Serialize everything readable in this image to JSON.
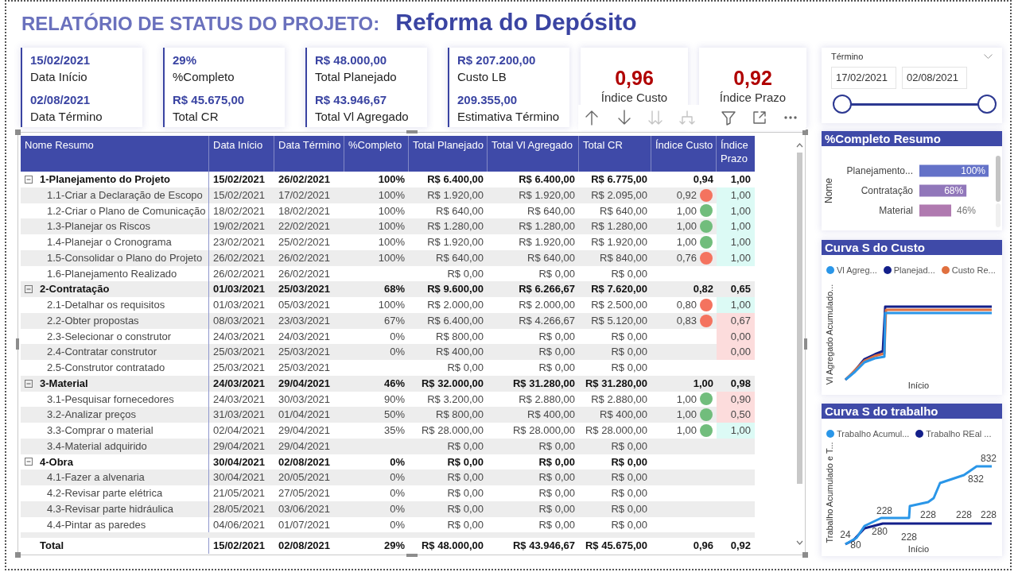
{
  "title": {
    "prefix": "RELATÓRIO DE STATUS DO PROJETO:",
    "project": "Reforma do Depósito"
  },
  "kpi_cards": [
    {
      "kind": "pair",
      "items": [
        {
          "value": "15/02/2021",
          "label": "Data Início"
        },
        {
          "value": "02/08/2021",
          "label": "Data Término"
        }
      ]
    },
    {
      "kind": "pair",
      "items": [
        {
          "value": "29%",
          "label": "%Completo"
        },
        {
          "value": "R$ 45.675,00",
          "label": "Total CR"
        }
      ]
    },
    {
      "kind": "pair",
      "items": [
        {
          "value": "R$ 48.000,00",
          "label": "Total Planejado"
        },
        {
          "value": "R$ 43.946,67",
          "label": "Total Vl Agregado"
        }
      ]
    },
    {
      "kind": "pair",
      "items": [
        {
          "value": "R$ 207.200,00",
          "label": "Custo LB"
        },
        {
          "value": "209.355,00",
          "label": "Estimativa Término"
        }
      ]
    },
    {
      "kind": "index",
      "value": "0,96",
      "label": "Índice Custo"
    },
    {
      "kind": "index",
      "value": "0,92",
      "label": "Índice Prazo"
    }
  ],
  "table_toolbar": [
    {
      "kind": "up",
      "disabled": false
    },
    {
      "kind": "down",
      "disabled": false
    },
    {
      "kind": "drilldown",
      "disabled": true
    },
    {
      "kind": "expand",
      "disabled": true
    },
    {
      "kind": "filter",
      "disabled": false
    },
    {
      "kind": "focus",
      "disabled": false
    },
    {
      "kind": "more",
      "disabled": false
    }
  ],
  "table": {
    "columns": [
      "Nome Resumo",
      "Data Início",
      "Data Término",
      "%Completo",
      "Total Planejado",
      "Total Vl Agregado",
      "Total CR",
      "Índice Custo",
      "Índice Prazo"
    ],
    "rows": [
      {
        "kind": "group",
        "expanded": true,
        "name": "1-Planejamento do Projeto",
        "start": "15/02/2021",
        "end": "26/02/2021",
        "complete": "100%",
        "planned": "R$ 6.400,00",
        "earned": "R$ 6.400,00",
        "actual": "R$ 6.775,00",
        "cost_index": {
          "value": "0,94"
        },
        "schedule_index": {
          "value": "1,00"
        }
      },
      {
        "kind": "task",
        "name": "1.1-Criar a Declaração de Escopo",
        "start": "15/02/2021",
        "end": "17/02/2021",
        "complete": "100%",
        "planned": "R$ 1.920,00",
        "earned": "R$ 1.920,00",
        "actual": "R$ 2.095,00",
        "cost_index": {
          "value": "0,92",
          "color": "#f4735f"
        },
        "schedule_index": {
          "value": "1,00",
          "color": "#dcfaf5"
        }
      },
      {
        "kind": "task",
        "name": "1.2-Criar o Plano de Comunicação",
        "start": "18/02/2021",
        "end": "18/02/2021",
        "complete": "100%",
        "planned": "R$ 640,00",
        "earned": "R$ 640,00",
        "actual": "R$ 640,00",
        "cost_index": {
          "value": "1,00",
          "color": "#71bd7c"
        },
        "schedule_index": {
          "value": "1,00",
          "color": "#dcfaf5"
        }
      },
      {
        "kind": "task",
        "name": "1.3-Planejar os Riscos",
        "start": "19/02/2021",
        "end": "22/02/2021",
        "complete": "100%",
        "planned": "R$ 1.280,00",
        "earned": "R$ 1.280,00",
        "actual": "R$ 1.280,00",
        "cost_index": {
          "value": "1,00",
          "color": "#71bd7c"
        },
        "schedule_index": {
          "value": "1,00",
          "color": "#dcfaf5"
        }
      },
      {
        "kind": "task",
        "name": "1.4-Planejar o Cronograma",
        "start": "23/02/2021",
        "end": "25/02/2021",
        "complete": "100%",
        "planned": "R$ 1.920,00",
        "earned": "R$ 1.920,00",
        "actual": "R$ 1.920,00",
        "cost_index": {
          "value": "1,00",
          "color": "#71bd7c"
        },
        "schedule_index": {
          "value": "1,00",
          "color": "#dcfaf5"
        }
      },
      {
        "kind": "task",
        "name": "1.5-Consolidar o Plano do Projeto",
        "start": "26/02/2021",
        "end": "26/02/2021",
        "complete": "100%",
        "planned": "R$ 640,00",
        "earned": "R$ 640,00",
        "actual": "R$ 840,00",
        "cost_index": {
          "value": "0,76",
          "color": "#f4735f"
        },
        "schedule_index": {
          "value": "1,00",
          "color": "#dcfaf5"
        }
      },
      {
        "kind": "task",
        "name": "1.6-Planejamento Realizado",
        "start": "26/02/2021",
        "end": "26/02/2021",
        "planned": "R$ 0,00",
        "earned": "R$ 0,00",
        "actual": "R$ 0,00"
      },
      {
        "kind": "group",
        "expanded": true,
        "name": "2-Contratação",
        "start": "01/03/2021",
        "end": "25/03/2021",
        "complete": "68%",
        "planned": "R$ 9.600,00",
        "earned": "R$ 6.266,67",
        "actual": "R$ 7.620,00",
        "cost_index": {
          "value": "0,82"
        },
        "schedule_index": {
          "value": "0,65"
        }
      },
      {
        "kind": "task",
        "name": "2.1-Detalhar os requisitos",
        "start": "01/03/2021",
        "end": "05/03/2021",
        "complete": "100%",
        "planned": "R$ 2.000,00",
        "earned": "R$ 2.000,00",
        "actual": "R$ 2.500,00",
        "cost_index": {
          "value": "0,80",
          "color": "#f4735f"
        },
        "schedule_index": {
          "value": "1,00",
          "color": "#dcfaf5"
        }
      },
      {
        "kind": "task",
        "name": "2.2-Obter propostas",
        "start": "08/03/2021",
        "end": "23/03/2021",
        "complete": "67%",
        "planned": "R$ 6.400,00",
        "earned": "R$ 4.266,67",
        "actual": "R$ 5.120,00",
        "cost_index": {
          "value": "0,83",
          "color": "#f4735f"
        },
        "schedule_index": {
          "value": "0,67",
          "color": "#fcdcdc"
        }
      },
      {
        "kind": "task",
        "name": "2.3-Selecionar o construtor",
        "start": "24/03/2021",
        "end": "24/03/2021",
        "complete": "0%",
        "planned": "R$ 800,00",
        "earned": "R$ 0,00",
        "actual": "R$ 0,00",
        "schedule_index": {
          "value": "0,00",
          "color": "#fcdcdc"
        }
      },
      {
        "kind": "task",
        "name": "2.4-Contratar construtor",
        "start": "25/03/2021",
        "end": "25/03/2021",
        "complete": "0%",
        "planned": "R$ 400,00",
        "earned": "R$ 0,00",
        "actual": "R$ 0,00",
        "schedule_index": {
          "value": "0,00",
          "color": "#fcdcdc"
        }
      },
      {
        "kind": "task",
        "name": "2.5-Construtor contratado",
        "start": "25/03/2021",
        "end": "25/03/2021",
        "planned": "R$ 0,00",
        "earned": "R$ 0,00",
        "actual": "R$ 0,00"
      },
      {
        "kind": "group",
        "expanded": true,
        "name": "3-Material",
        "start": "24/03/2021",
        "end": "29/04/2021",
        "complete": "46%",
        "planned": "R$ 32.000,00",
        "earned": "R$ 31.280,00",
        "actual": "R$ 31.280,00",
        "cost_index": {
          "value": "1,00"
        },
        "schedule_index": {
          "value": "0,98"
        }
      },
      {
        "kind": "task",
        "name": "3.1-Pesquisar fornecedores",
        "start": "24/03/2021",
        "end": "30/03/2021",
        "complete": "90%",
        "planned": "R$ 3.200,00",
        "earned": "R$ 2.880,00",
        "actual": "R$ 2.880,00",
        "cost_index": {
          "value": "1,00",
          "color": "#71bd7c"
        },
        "schedule_index": {
          "value": "0,90",
          "color": "#fcdcdc"
        }
      },
      {
        "kind": "task",
        "name": "3.2-Analizar preços",
        "start": "31/03/2021",
        "end": "01/04/2021",
        "complete": "50%",
        "planned": "R$ 800,00",
        "earned": "R$ 400,00",
        "actual": "R$ 400,00",
        "cost_index": {
          "value": "1,00",
          "color": "#71bd7c"
        },
        "schedule_index": {
          "value": "0,50",
          "color": "#fcdcdc"
        }
      },
      {
        "kind": "task",
        "name": "3.3-Comprar o material",
        "start": "02/04/2021",
        "end": "29/04/2021",
        "complete": "35%",
        "planned": "R$ 28.000,00",
        "earned": "R$ 28.000,00",
        "actual": "R$ 28.000,00",
        "cost_index": {
          "value": "1,00",
          "color": "#71bd7c"
        },
        "schedule_index": {
          "value": "1,00",
          "color": "#dcfaf5"
        }
      },
      {
        "kind": "task",
        "name": "3.4-Material adquirido",
        "start": "29/04/2021",
        "end": "29/04/2021",
        "planned": "R$ 0,00",
        "earned": "R$ 0,00",
        "actual": "R$ 0,00"
      },
      {
        "kind": "group",
        "expanded": true,
        "name": "4-Obra",
        "start": "30/04/2021",
        "end": "02/08/2021",
        "complete": "0%",
        "planned": "R$ 0,00",
        "earned": "R$ 0,00",
        "actual": "R$ 0,00"
      },
      {
        "kind": "task",
        "name": "4.1-Fazer a alvenaria",
        "start": "30/04/2021",
        "end": "20/05/2021",
        "complete": "0%",
        "planned": "R$ 0,00",
        "earned": "R$ 0,00",
        "actual": "R$ 0,00"
      },
      {
        "kind": "task",
        "name": "4.2-Revisar parte elétrica",
        "start": "21/05/2021",
        "end": "27/05/2021",
        "complete": "0%",
        "planned": "R$ 0,00",
        "earned": "R$ 0,00",
        "actual": "R$ 0,00"
      },
      {
        "kind": "task",
        "name": "4.3-Revisar parte hidráulica",
        "start": "28/05/2021",
        "end": "03/06/2021",
        "complete": "0%",
        "planned": "R$ 0,00",
        "earned": "R$ 0,00",
        "actual": "R$ 0,00"
      },
      {
        "kind": "task",
        "name": "4.4-Pintar as paredes",
        "start": "04/06/2021",
        "end": "01/07/2021",
        "complete": "0%",
        "planned": "R$ 0,00",
        "earned": "R$ 0,00",
        "actual": "R$ 0,00"
      }
    ],
    "total": {
      "name": "Total",
      "start": "15/02/2021",
      "end": "02/08/2021",
      "complete": "29%",
      "planned": "R$ 48.000,00",
      "earned": "R$ 43.946,67",
      "actual": "R$ 45.675,00",
      "cost_index": {
        "value": "0,96"
      },
      "schedule_index": {
        "value": "0,92"
      }
    }
  },
  "date_slicer": {
    "label": "Término",
    "start": "17/02/2021",
    "end": "02/08/2021",
    "thumbs": [
      {
        "level": 0
      },
      {
        "level": 1
      }
    ]
  },
  "complete_summary": {
    "title": "%Completo Resumo",
    "chart_data": {
      "type": "bar",
      "orientation": "horizontal",
      "ylabel": "Nome",
      "categories": [
        "Planejamento...",
        "Contratação",
        "Material"
      ],
      "values": [
        1,
        0.68,
        0.46
      ],
      "value_labels": [
        "100%",
        "68%",
        "46%"
      ]
    }
  },
  "curve_cards": [
    {
      "kind": "cost",
      "title": "Curva S do Custo",
      "legend": [
        {
          "label": "Vl Agreg...",
          "color": "#2a96e8"
        },
        {
          "label": "Planejad...",
          "color": "#131f8a"
        },
        {
          "label": "Custo Re...",
          "color": "#e0703f"
        }
      ],
      "ylabel": "Vl Agregado Acumulado...",
      "xlabel": "Início"
    },
    {
      "kind": "work",
      "title": "Curva S do trabalho",
      "legend": [
        {
          "label": "Trabalho Acumul...",
          "color": "#2a96e8"
        },
        {
          "label": "Trabalho REal ...",
          "color": "#131f8a"
        }
      ],
      "ylabel": "Trabalho Acumulado e T...",
      "xlabel": "Início",
      "point_labels": [
        "832",
        "832",
        "228",
        "228",
        "228",
        "228",
        "280",
        "228",
        "24",
        "80"
      ]
    }
  ]
}
